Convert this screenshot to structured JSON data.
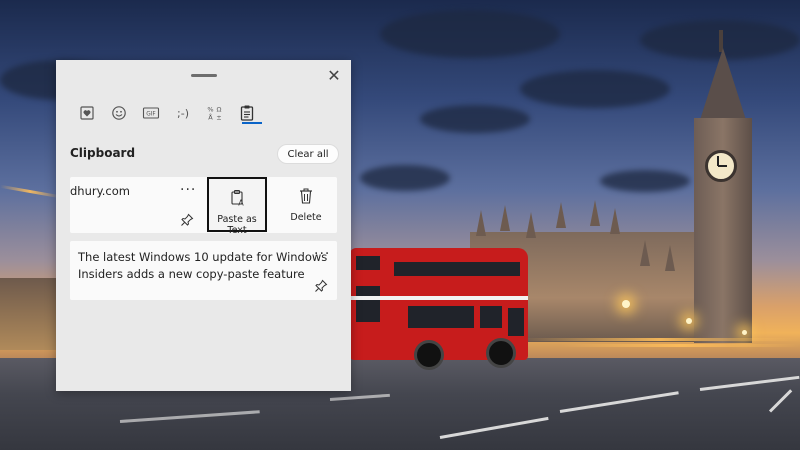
{
  "panel": {
    "title": "Clipboard",
    "clear_all_label": "Clear all",
    "close_glyph": "✕",
    "tabs": [
      {
        "name": "emoji-favorites-icon",
        "glyph": "♥"
      },
      {
        "name": "emoji-icon",
        "glyph": "☺"
      },
      {
        "name": "gif-icon",
        "glyph": "GIF"
      },
      {
        "name": "kaomoji-icon",
        "glyph": ";-)"
      },
      {
        "name": "symbols-icon",
        "glyph": "%Ω"
      },
      {
        "name": "clipboard-icon",
        "glyph": "📋"
      }
    ],
    "items": [
      {
        "text": "dhury.com",
        "more_glyph": "···",
        "actions": {
          "paste_as_text_label": "Paste as Text",
          "delete_label": "Delete"
        }
      },
      {
        "text_line1": "The latest Windows 10 update for Windows",
        "text_line2": "Insiders adds a new copy-paste feature",
        "more_glyph": "···"
      }
    ]
  },
  "colors": {
    "accent": "#0a64c8",
    "panel_bg": "#e9e9e9",
    "card_bg": "#fafafa"
  }
}
